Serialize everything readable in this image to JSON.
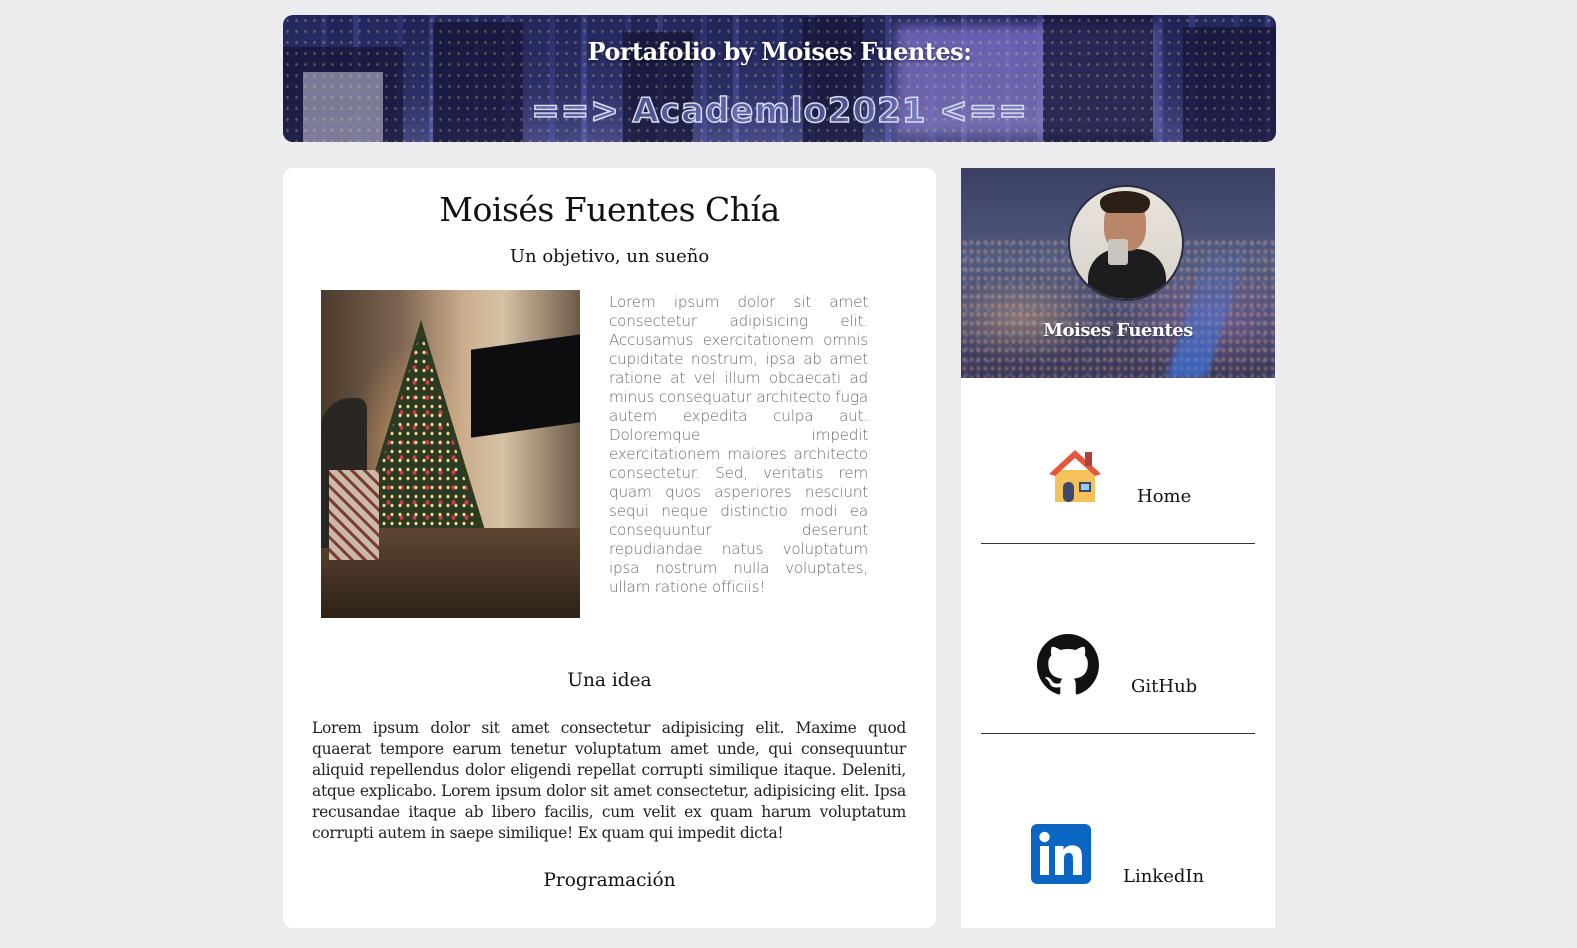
{
  "header": {
    "title": "Portafolio by Moises Fuentes:",
    "subtitle": "==> Academlo2021 <=="
  },
  "main": {
    "name": "Moisés Fuentes Chía",
    "tagline": "Un objetivo, un sueño",
    "intro_text": "Lorem ipsum dolor sit amet consectetur adipisicing elit. Accusamus exercitationem omnis cupiditate nostrum, ipsa ab amet ratione at vel illum obcaecati ad minus consequatur architecto fuga autem expedita culpa aut. Doloremque impedit exercitationem maiores architecto consectetur. Sed, veritatis rem quam quos asperiores nesciunt sequi neque distinctio modi ea consequuntur deserunt repudiandae natus voluptatum ipsa nostrum nulla voluptates, ullam ratione officiis!",
    "idea_heading": "Una idea",
    "idea_text": "Lorem ipsum dolor sit amet consectetur adipisicing elit. Maxime quod quaerat tempore earum tenetur voluptatum amet unde, qui consequuntur aliquid repellendus dolor eligendi repellat corrupti similique itaque. Deleniti, atque explicabo. Lorem ipsum dolor sit amet consectetur, adipisicing elit. Ipsa recusandae itaque ab libero facilis, cum velit ex quam harum voluptatum corrupti autem in saepe similique! Ex quam qui impedit dicta!",
    "programming_heading": "Programación"
  },
  "sidebar": {
    "profile_name": "Moises Fuentes",
    "nav": [
      {
        "label": "Home",
        "icon": "house-icon"
      },
      {
        "label": "GitHub",
        "icon": "github-icon"
      },
      {
        "label": "LinkedIn",
        "icon": "linkedin-icon"
      }
    ]
  },
  "colors": {
    "page_bg": "#ececee",
    "card_bg": "#ffffff",
    "linkedin_blue": "#0a66c2",
    "house_roof": "#e4573f"
  }
}
